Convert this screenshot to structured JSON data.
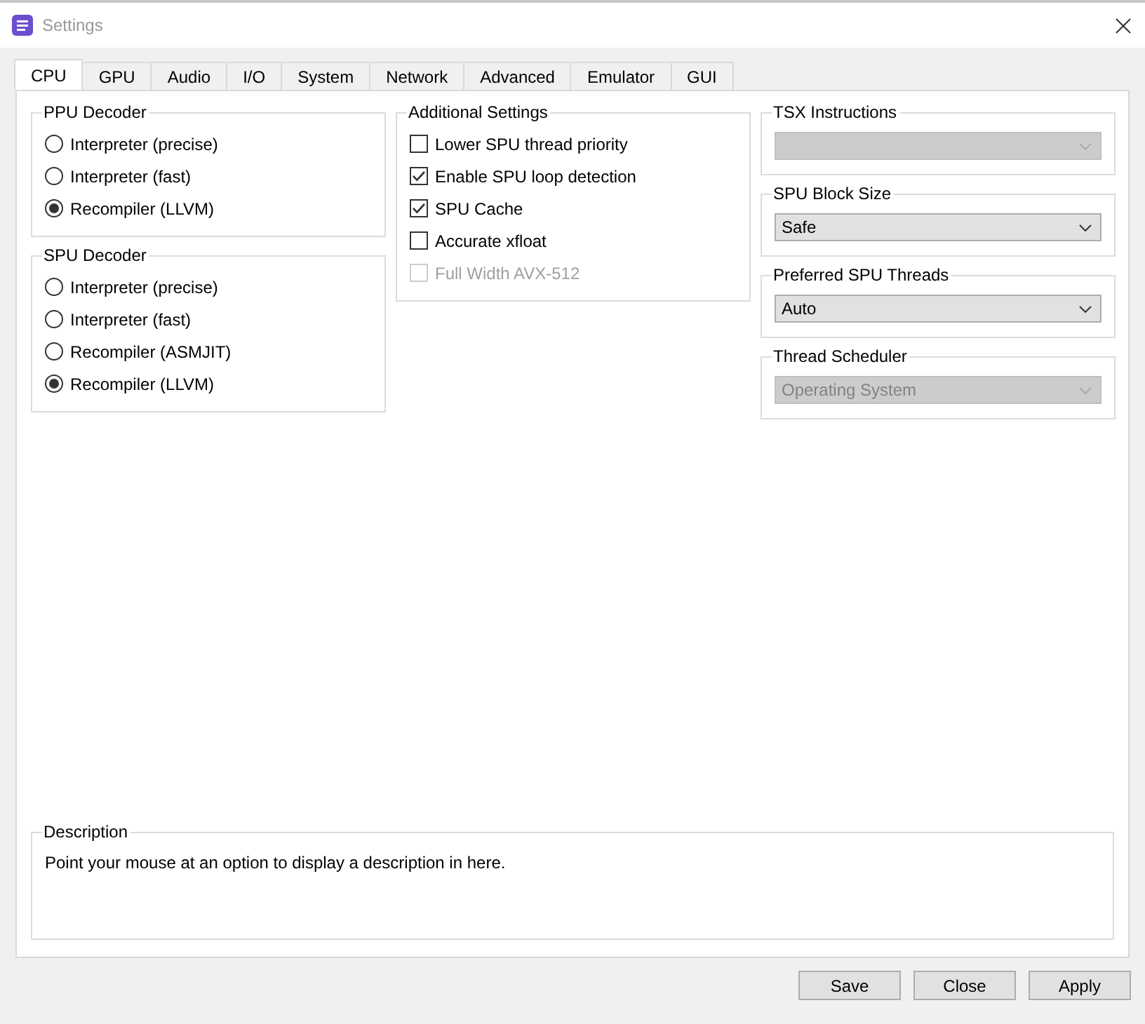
{
  "window": {
    "title": "Settings"
  },
  "tabs": [
    {
      "label": "CPU",
      "selected": true
    },
    {
      "label": "GPU",
      "selected": false
    },
    {
      "label": "Audio",
      "selected": false
    },
    {
      "label": "I/O",
      "selected": false
    },
    {
      "label": "System",
      "selected": false
    },
    {
      "label": "Network",
      "selected": false
    },
    {
      "label": "Advanced",
      "selected": false
    },
    {
      "label": "Emulator",
      "selected": false
    },
    {
      "label": "GUI",
      "selected": false
    }
  ],
  "ppu_decoder": {
    "title": "PPU Decoder",
    "options": [
      {
        "label": "Interpreter (precise)",
        "selected": false
      },
      {
        "label": "Interpreter (fast)",
        "selected": false
      },
      {
        "label": "Recompiler (LLVM)",
        "selected": true
      }
    ]
  },
  "spu_decoder": {
    "title": "SPU Decoder",
    "options": [
      {
        "label": "Interpreter (precise)",
        "selected": false
      },
      {
        "label": "Interpreter (fast)",
        "selected": false
      },
      {
        "label": "Recompiler (ASMJIT)",
        "selected": false
      },
      {
        "label": "Recompiler (LLVM)",
        "selected": true
      }
    ]
  },
  "additional_settings": {
    "title": "Additional Settings",
    "options": [
      {
        "label": "Lower SPU thread priority",
        "checked": false,
        "disabled": false
      },
      {
        "label": "Enable SPU loop detection",
        "checked": true,
        "disabled": false
      },
      {
        "label": "SPU Cache",
        "checked": true,
        "disabled": false
      },
      {
        "label": "Accurate xfloat",
        "checked": false,
        "disabled": false
      },
      {
        "label": "Full Width AVX-512",
        "checked": false,
        "disabled": true
      }
    ]
  },
  "dropdowns": [
    {
      "title": "TSX Instructions",
      "disabled": true
    },
    {
      "title": "SPU Block Size",
      "value": "Safe",
      "disabled": false
    },
    {
      "title": "Preferred SPU Threads",
      "value": "Auto",
      "disabled": false
    },
    {
      "title": "Thread Scheduler",
      "value": "Operating System",
      "disabled": true
    }
  ],
  "description": {
    "title": "Description",
    "text": "Point your mouse at an option to display a description in here."
  },
  "buttons": [
    "Save",
    "Close",
    "Apply"
  ]
}
